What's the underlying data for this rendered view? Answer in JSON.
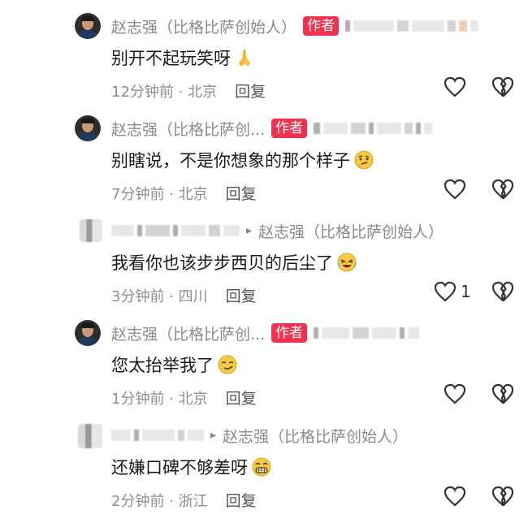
{
  "comments": [
    {
      "author": "赵志强（比格比萨创始人）",
      "badge": "作者",
      "text": "别开不起玩笑呀",
      "time": "12分钟前",
      "location": "北京",
      "reply_label": "回复",
      "like_count": "",
      "emoji": "praying-hands"
    },
    {
      "author": "赵志强（比格比萨创...",
      "badge": "作者",
      "text": "别瞎说，不是你想象的那个样子",
      "time": "7分钟前",
      "location": "北京",
      "reply_label": "回复",
      "like_count": "",
      "emoji": "thinking-face"
    },
    {
      "author": "赵志强（比格比萨创始人）",
      "reply_to_label": "▸",
      "text": "我看你也该步步西贝的后尘了",
      "time": "3分钟前",
      "location": "四川",
      "reply_label": "回复",
      "like_count": "1",
      "emoji": "laughing-crying-face"
    },
    {
      "author": "赵志强（比格比萨创...",
      "badge": "作者",
      "text": "您太抬举我了",
      "time": "1分钟前",
      "location": "北京",
      "reply_label": "回复",
      "like_count": "",
      "emoji": "smirking-face"
    },
    {
      "author": "赵志强（比格比萨创始人）",
      "reply_to_label": "▸",
      "text": "还嫌口碑不够差呀",
      "time": "2分钟前",
      "location": "浙江",
      "reply_label": "回复",
      "like_count": "",
      "emoji": "grinning-face"
    }
  ],
  "colors": {
    "badge": "#f0324e",
    "name": "#8a8a8a",
    "text": "#1a1a1a",
    "meta": "#8e8e8e"
  }
}
